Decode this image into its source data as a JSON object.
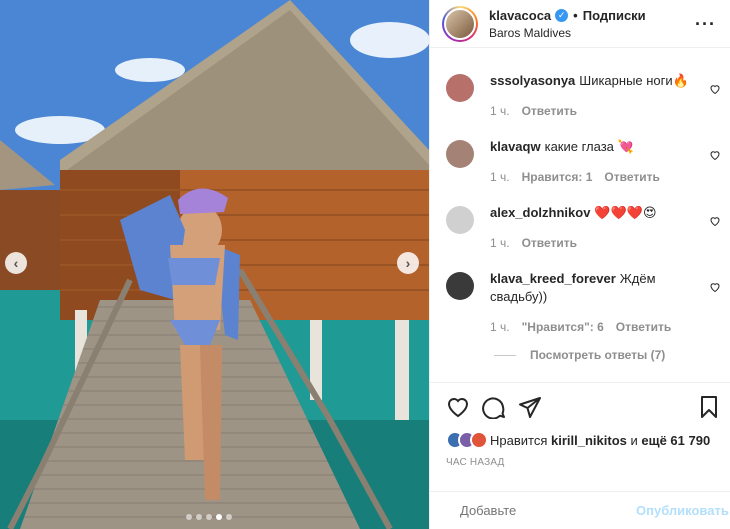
{
  "post": {
    "username": "klavacoca",
    "separator": "•",
    "follow_state": "Подписки",
    "location": "Baros Maldives",
    "more": "···"
  },
  "comments": [
    {
      "user": "sssolyasonya",
      "text": "Шикарные ноги🔥",
      "time": "1 ч.",
      "likes": "",
      "reply": "Ответить",
      "avatar_color": "#b7706a"
    },
    {
      "user": "klavaqw",
      "text": "какие глаза 💘",
      "time": "1 ч.",
      "likes": "Нравится: 1",
      "reply": "Ответить",
      "avatar_color": "#a58276"
    },
    {
      "user": "alex_dolzhnikov",
      "text": "❤️❤️❤️😍",
      "time": "1 ч.",
      "likes": "",
      "reply": "Ответить",
      "avatar_color": "#c9c9c9"
    },
    {
      "user": "klava_kreed_forever",
      "text": "Ждём свадьбу))",
      "time": "1 ч.",
      "likes": "\"Нравится\": 6",
      "reply": "Ответить",
      "avatar_color": "#3a3a3a"
    }
  ],
  "view_replies": "Посмотреть ответы (7)",
  "likes": {
    "prefix": "Нравится",
    "user": "kirill_nikitos",
    "middle": "и",
    "rest": "ещё 61 790"
  },
  "time_ago": "ЧАС НАЗАД",
  "add_comment": {
    "placeholder": "Добавьте",
    "publish": "Опубликовать"
  },
  "colors": {
    "accent": "#3897f0",
    "publish_disabled": "#b2dffc",
    "text": "#262626",
    "muted": "#8e8e8e"
  }
}
